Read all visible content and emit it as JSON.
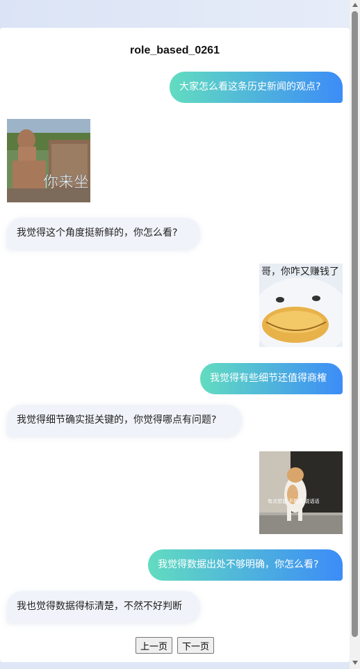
{
  "header": {
    "title": "role_based_0261"
  },
  "messages": [
    {
      "role": "user",
      "text": "大家怎么看这条历史新闻的观点?"
    },
    {
      "role": "bot",
      "sticker_text": "你来坐"
    },
    {
      "role": "bot",
      "text": "我觉得这个角度挺新鲜的，你怎么看?"
    },
    {
      "role": "user",
      "sticker_text": "哥，你咋又赚钱了"
    },
    {
      "role": "user",
      "text": "我觉得有些细节还值得商榷"
    },
    {
      "role": "bot",
      "text": "我觉得细节确实挺关键的，你觉得哪点有问题?"
    },
    {
      "role": "user",
      "sticker_text": "有点想鼠 不敢说 说话话"
    },
    {
      "role": "user",
      "text": "我觉得数据出处不够明确，你怎么看?"
    },
    {
      "role": "bot",
      "text": "我也觉得数据得标清楚，不然不好判断"
    }
  ],
  "pager": {
    "prev_label": "上一页",
    "next_label": "下一页"
  },
  "colors": {
    "user_gradient_start": "#62dcc0",
    "user_gradient_end": "#3c8cf7",
    "bot_bubble": "#f0f3f9"
  }
}
